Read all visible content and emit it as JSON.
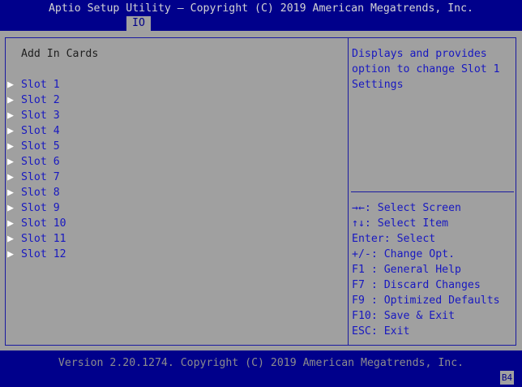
{
  "header": {
    "title": "Aptio Setup Utility – Copyright (C) 2019 American Megatrends, Inc.",
    "active_tab": "IO"
  },
  "main": {
    "section_title": "Add In Cards",
    "items": [
      {
        "label": "Slot 1"
      },
      {
        "label": "Slot 2"
      },
      {
        "label": "Slot 3"
      },
      {
        "label": "Slot 4"
      },
      {
        "label": "Slot 5"
      },
      {
        "label": "Slot 6"
      },
      {
        "label": "Slot 7"
      },
      {
        "label": "Slot 8"
      },
      {
        "label": "Slot 9"
      },
      {
        "label": "Slot 10"
      },
      {
        "label": "Slot 11"
      },
      {
        "label": "Slot 12"
      }
    ]
  },
  "help": {
    "text": "Displays and provides option to change Slot 1 Settings",
    "keys": [
      "→←: Select Screen",
      "↑↓: Select Item",
      "Enter: Select",
      "+/-: Change Opt.",
      "F1 : General Help",
      "F7 : Discard Changes",
      "F9 : Optimized Defaults",
      "F10: Save & Exit",
      "ESC: Exit"
    ]
  },
  "footer": {
    "version": "Version 2.20.1274. Copyright (C) 2019 American Megatrends, Inc.",
    "code": "B4"
  },
  "icons": {
    "submenu_arrow": "▶"
  },
  "colors": {
    "background": "#00008b",
    "panel": "#a0a0a0",
    "accent_text": "#1818c0"
  }
}
